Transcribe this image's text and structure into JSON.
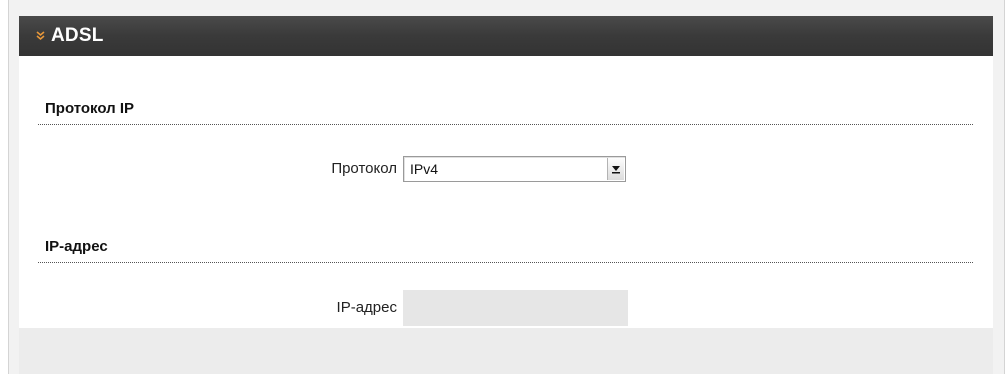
{
  "header": {
    "title": "ADSL",
    "icon": "chevron-double-down-icon",
    "accent_color": "#e8983a"
  },
  "sections": {
    "ip_protocol": {
      "title": "Протокол IP",
      "protocol_label": "Протокол",
      "protocol_value": "IPv4"
    },
    "ip_address": {
      "title": "IP-адрес",
      "address_label": "IP-адрес",
      "address_value": ""
    }
  }
}
